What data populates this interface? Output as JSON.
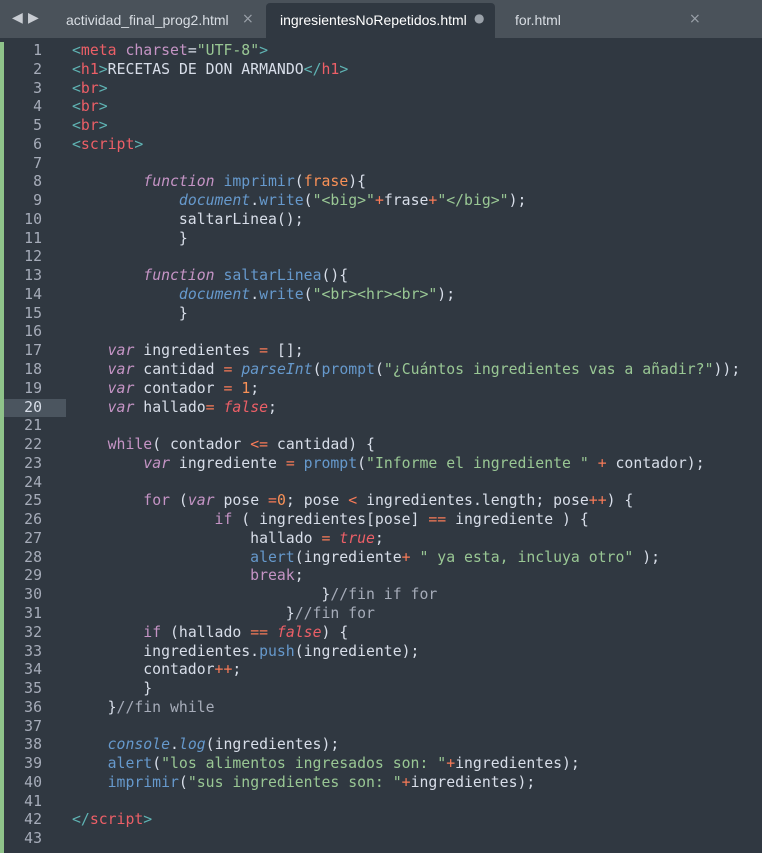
{
  "tabs": [
    {
      "label": "actividad_final_prog2.html",
      "close": "×",
      "active": false
    },
    {
      "label": "ingresientesNoRepetidos.html",
      "close": "●",
      "active": true
    },
    {
      "label": "for.html",
      "close": "×",
      "active": false
    }
  ],
  "nav": {
    "back": "◀",
    "forward": "▶"
  },
  "current_line": 20,
  "lines": [
    [
      [
        "pt",
        "<"
      ],
      [
        "t",
        "meta"
      ],
      [
        "a",
        " charset"
      ],
      [
        "p",
        "="
      ],
      [
        "s",
        "\"UTF-8\""
      ],
      [
        "pt",
        ">"
      ]
    ],
    [
      [
        "pt",
        "<"
      ],
      [
        "t",
        "h1"
      ],
      [
        "pt",
        ">"
      ],
      [
        "p",
        "RECETAS DE DON ARMANDO"
      ],
      [
        "pt",
        "</"
      ],
      [
        "t",
        "h1"
      ],
      [
        "pt",
        ">"
      ]
    ],
    [
      [
        "pt",
        "<"
      ],
      [
        "t",
        "br"
      ],
      [
        "pt",
        ">"
      ]
    ],
    [
      [
        "pt",
        "<"
      ],
      [
        "t",
        "br"
      ],
      [
        "pt",
        ">"
      ]
    ],
    [
      [
        "pt",
        "<"
      ],
      [
        "t",
        "br"
      ],
      [
        "pt",
        ">"
      ]
    ],
    [
      [
        "pt",
        "<"
      ],
      [
        "t",
        "script"
      ],
      [
        "pt",
        ">"
      ]
    ],
    [],
    [
      [
        "p",
        "        "
      ],
      [
        "ki",
        "function"
      ],
      [
        "p",
        " "
      ],
      [
        "f",
        "imprimir"
      ],
      [
        "p",
        "("
      ],
      [
        "n",
        "frase"
      ],
      [
        "p",
        "){"
      ]
    ],
    [
      [
        "p",
        "            "
      ],
      [
        "fi",
        "document"
      ],
      [
        "p",
        "."
      ],
      [
        "f",
        "write"
      ],
      [
        "p",
        "("
      ],
      [
        "s",
        "\"<big>\""
      ],
      [
        "o",
        "+"
      ],
      [
        "p",
        "frase"
      ],
      [
        "o",
        "+"
      ],
      [
        "s",
        "\"</big>\""
      ],
      [
        "p",
        ");"
      ]
    ],
    [
      [
        "p",
        "            saltarLinea();"
      ]
    ],
    [
      [
        "p",
        "            }"
      ]
    ],
    [],
    [
      [
        "p",
        "        "
      ],
      [
        "ki",
        "function"
      ],
      [
        "p",
        " "
      ],
      [
        "f",
        "saltarLinea"
      ],
      [
        "p",
        "(){"
      ]
    ],
    [
      [
        "p",
        "            "
      ],
      [
        "fi",
        "document"
      ],
      [
        "p",
        "."
      ],
      [
        "f",
        "write"
      ],
      [
        "p",
        "("
      ],
      [
        "s",
        "\"<br><hr><br>\""
      ],
      [
        "p",
        ");"
      ]
    ],
    [
      [
        "p",
        "            }"
      ]
    ],
    [],
    [
      [
        "p",
        "    "
      ],
      [
        "ki",
        "var"
      ],
      [
        "p",
        " ingredientes "
      ],
      [
        "o",
        "="
      ],
      [
        "p",
        " [];"
      ]
    ],
    [
      [
        "p",
        "    "
      ],
      [
        "ki",
        "var"
      ],
      [
        "p",
        " cantidad "
      ],
      [
        "o",
        "="
      ],
      [
        "p",
        " "
      ],
      [
        "fi",
        "parseInt"
      ],
      [
        "p",
        "("
      ],
      [
        "f",
        "prompt"
      ],
      [
        "p",
        "("
      ],
      [
        "s",
        "\"¿Cuántos ingredientes vas a añadir?\""
      ],
      [
        "p",
        "));"
      ]
    ],
    [
      [
        "p",
        "    "
      ],
      [
        "ki",
        "var"
      ],
      [
        "p",
        " contador "
      ],
      [
        "o",
        "="
      ],
      [
        "p",
        " "
      ],
      [
        "n",
        "1"
      ],
      [
        "p",
        ";"
      ]
    ],
    [
      [
        "p",
        "    "
      ],
      [
        "ki",
        "var"
      ],
      [
        "p",
        " hallado"
      ],
      [
        "o",
        "="
      ],
      [
        "p",
        " "
      ],
      [
        "b",
        "false"
      ],
      [
        "p",
        ";"
      ]
    ],
    [],
    [
      [
        "p",
        "    "
      ],
      [
        "k",
        "while"
      ],
      [
        "p",
        "( contador "
      ],
      [
        "o",
        "<="
      ],
      [
        "p",
        " cantidad) {"
      ]
    ],
    [
      [
        "p",
        "        "
      ],
      [
        "ki",
        "var"
      ],
      [
        "p",
        " ingrediente "
      ],
      [
        "o",
        "="
      ],
      [
        "p",
        " "
      ],
      [
        "f",
        "prompt"
      ],
      [
        "p",
        "("
      ],
      [
        "s",
        "\"Informe el ingrediente \""
      ],
      [
        "p",
        " "
      ],
      [
        "o",
        "+"
      ],
      [
        "p",
        " contador);"
      ]
    ],
    [],
    [
      [
        "p",
        "        "
      ],
      [
        "k",
        "for"
      ],
      [
        "p",
        " ("
      ],
      [
        "ki",
        "var"
      ],
      [
        "p",
        " pose "
      ],
      [
        "o",
        "="
      ],
      [
        "n",
        "0"
      ],
      [
        "p",
        "; pose "
      ],
      [
        "o",
        "<"
      ],
      [
        "p",
        " ingredientes.length; pose"
      ],
      [
        "o",
        "++"
      ],
      [
        "p",
        ") {"
      ]
    ],
    [
      [
        "p",
        "                "
      ],
      [
        "k",
        "if"
      ],
      [
        "p",
        " ( ingredientes[pose] "
      ],
      [
        "o",
        "=="
      ],
      [
        "p",
        " ingrediente ) {"
      ]
    ],
    [
      [
        "p",
        "                    hallado "
      ],
      [
        "o",
        "="
      ],
      [
        "p",
        " "
      ],
      [
        "b",
        "true"
      ],
      [
        "p",
        ";"
      ]
    ],
    [
      [
        "p",
        "                    "
      ],
      [
        "f",
        "alert"
      ],
      [
        "p",
        "(ingrediente"
      ],
      [
        "o",
        "+"
      ],
      [
        "p",
        " "
      ],
      [
        "s",
        "\" ya esta, incluya otro\""
      ],
      [
        "p",
        " );"
      ]
    ],
    [
      [
        "p",
        "                    "
      ],
      [
        "k",
        "break"
      ],
      [
        "p",
        ";"
      ]
    ],
    [
      [
        "p",
        "                            }"
      ],
      [
        "c",
        "//fin if for"
      ]
    ],
    [
      [
        "p",
        "                        }"
      ],
      [
        "c",
        "//fin for"
      ]
    ],
    [
      [
        "p",
        "        "
      ],
      [
        "k",
        "if"
      ],
      [
        "p",
        " (hallado "
      ],
      [
        "o",
        "=="
      ],
      [
        "p",
        " "
      ],
      [
        "b",
        "false"
      ],
      [
        "p",
        ") {"
      ]
    ],
    [
      [
        "p",
        "        ingredientes."
      ],
      [
        "f",
        "push"
      ],
      [
        "p",
        "(ingrediente);"
      ]
    ],
    [
      [
        "p",
        "        contador"
      ],
      [
        "o",
        "++"
      ],
      [
        "p",
        ";"
      ]
    ],
    [
      [
        "p",
        "        }"
      ]
    ],
    [
      [
        "p",
        "    }"
      ],
      [
        "c",
        "//fin while"
      ]
    ],
    [],
    [
      [
        "p",
        "    "
      ],
      [
        "fi",
        "console"
      ],
      [
        "p",
        "."
      ],
      [
        "fi",
        "log"
      ],
      [
        "p",
        "(ingredientes);"
      ]
    ],
    [
      [
        "p",
        "    "
      ],
      [
        "f",
        "alert"
      ],
      [
        "p",
        "("
      ],
      [
        "s",
        "\"los alimentos ingresados son: \""
      ],
      [
        "o",
        "+"
      ],
      [
        "p",
        "ingredientes);"
      ]
    ],
    [
      [
        "p",
        "    "
      ],
      [
        "f",
        "imprimir"
      ],
      [
        "p",
        "("
      ],
      [
        "s",
        "\"sus ingredientes son: \""
      ],
      [
        "o",
        "+"
      ],
      [
        "p",
        "ingredientes);"
      ]
    ],
    [],
    [
      [
        "pt",
        "</"
      ],
      [
        "t",
        "script"
      ],
      [
        "pt",
        ">"
      ]
    ],
    []
  ]
}
